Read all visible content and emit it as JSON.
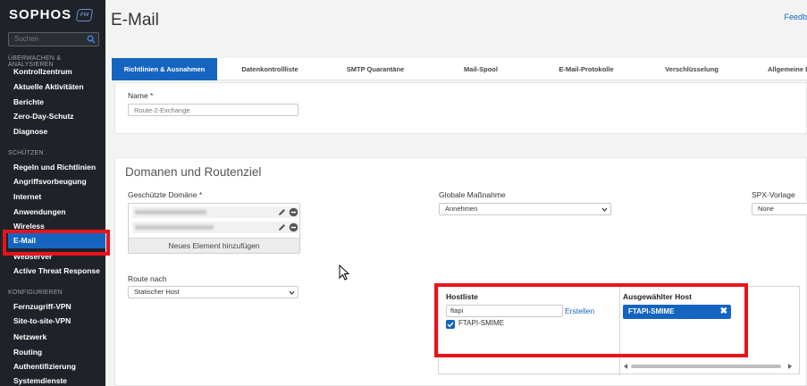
{
  "sidebar": {
    "logo": "SOPHOS",
    "logo_badge": "FW",
    "search_placeholder": "Suchen",
    "sections": [
      {
        "title": "ÜBERWACHEN & ANALYSIEREN",
        "items": [
          "Kontrollzentrum",
          "Aktuelle Aktivitäten",
          "Berichte",
          "Zero-Day-Schutz",
          "Diagnose"
        ]
      },
      {
        "title": "SCHÜTZEN",
        "items": [
          "Regeln und Richtlinien",
          "Angriffsvorbeugung",
          "Internet",
          "Anwendungen",
          "Wireless",
          "E-Mail",
          "Webserver",
          "Active Threat Response"
        ]
      },
      {
        "title": "KONFIGURIEREN",
        "items": [
          "Fernzugriff-VPN",
          "Site-to-site-VPN",
          "Netzwerk",
          "Routing",
          "Authentifizierung",
          "Systemdienste"
        ]
      }
    ],
    "active_item": "E-Mail"
  },
  "header": {
    "title": "E-Mail",
    "feedback": "Feedb"
  },
  "tabs": [
    {
      "label": "Richtlinien & Ausnahmen",
      "active": true
    },
    {
      "label": "Datenkontrollliste",
      "active": false
    },
    {
      "label": "SMTP Quarantäne",
      "active": false
    },
    {
      "label": "Mail-Spool",
      "active": false
    },
    {
      "label": "E-Mail-Protokolle",
      "active": false
    },
    {
      "label": "Verschlüsselung",
      "active": false
    },
    {
      "label": "Allgemeine E",
      "active": false
    }
  ],
  "form": {
    "name_label": "Name *",
    "name_placeholder": "Route-2-Exchange",
    "section_title": "Domanen und Routenziel",
    "protected_domain_label": "Geschützte Domäne *",
    "add_new_element": "Neues Element hinzufügen",
    "global_action_label": "Globale Maßnahme",
    "global_action_value": "Annehmen",
    "spx_label": "SPX-Vorlage",
    "spx_value": "None",
    "route_label": "Route nach",
    "route_value": "Statischer Host"
  },
  "host_list": {
    "title": "Hostliste",
    "filter_value": "ftapi",
    "create_link": "Erstellen",
    "items": [
      {
        "label": "FTAPI-SMIME",
        "checked": true
      }
    ],
    "selected_title": "Ausgewählter Host",
    "selected": [
      "FTAPI-SMIME"
    ]
  },
  "colors": {
    "accent": "#1565c0",
    "sidebar_bg": "#1f2329",
    "highlight_red": "#e8131b"
  }
}
